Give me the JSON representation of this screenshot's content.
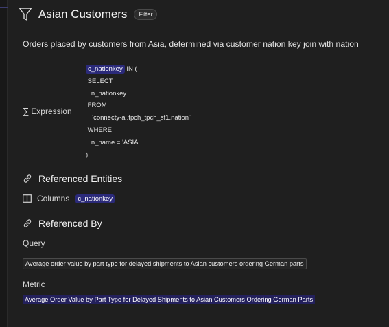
{
  "header": {
    "title": "Asian Customers",
    "badge": "Filter"
  },
  "description": "Orders placed by customers from Asia, determined via customer nation key join with nation",
  "expression": {
    "label": "Expression",
    "column_chip": "c_nationkey",
    "first_line_rest": " IN (",
    "lines": [
      " SELECT",
      "   n_nationkey",
      " FROM",
      "   `connecty-ai.tpch_tpch_sf1.nation`",
      " WHERE",
      "   n_name = 'ASIA'",
      ")"
    ]
  },
  "referenced_entities": {
    "title": "Referenced Entities",
    "columns_label": "Columns",
    "column_chip": "c_nationkey"
  },
  "referenced_by": {
    "title": "Referenced By",
    "query_label": "Query",
    "query_item": "Average order value by part type for delayed shipments to Asian customers ordering German parts",
    "metric_label": "Metric",
    "metric_item": "Average Order Value by Part Type for Delayed Shipments to Asian Customers Ordering German Parts"
  },
  "colors": {
    "background": "#1f1f1f",
    "chip": "#2b2a7a",
    "metric_chip": "#23205c"
  }
}
